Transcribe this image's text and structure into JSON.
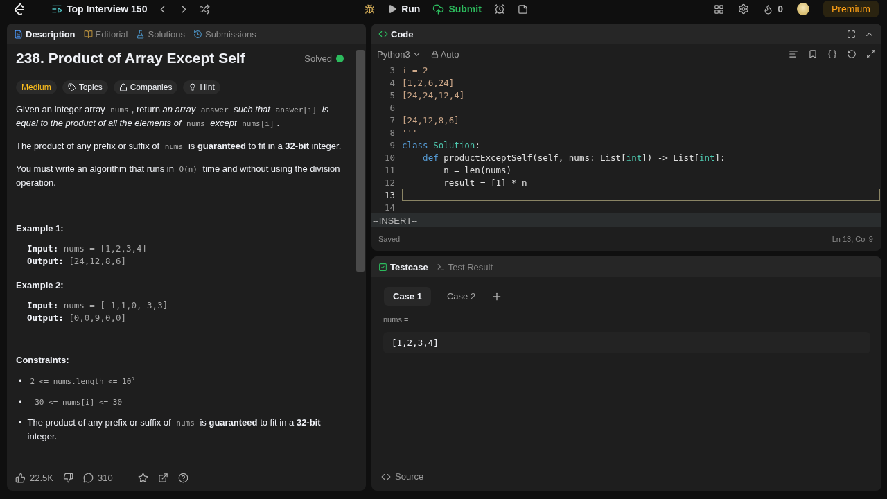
{
  "topbar": {
    "problem_list": "Top Interview 150",
    "run": "Run",
    "submit": "Submit",
    "streak": "0",
    "premium": "Premium"
  },
  "description_panel": {
    "tabs": [
      {
        "label": "Description",
        "selected": true
      },
      {
        "label": "Editorial",
        "selected": false
      },
      {
        "label": "Solutions",
        "selected": false
      },
      {
        "label": "Submissions",
        "selected": false
      }
    ],
    "title": "238. Product of Array Except Self",
    "status": "Solved",
    "difficulty": "Medium",
    "tags": [
      "Topics",
      "Companies",
      "Hint"
    ],
    "paragraphs": [
      [
        {
          "kind": "text",
          "t": "Given an integer array "
        },
        {
          "kind": "code",
          "t": "nums"
        },
        {
          "kind": "text",
          "t": ", return "
        },
        {
          "kind": "italic",
          "t": "an array "
        },
        {
          "kind": "code",
          "t": "answer"
        },
        {
          "kind": "italic",
          "t": " such that "
        },
        {
          "kind": "code",
          "t": "answer[i]"
        },
        {
          "kind": "italic",
          "t": " is equal to the product of all the elements of "
        },
        {
          "kind": "code",
          "t": "nums"
        },
        {
          "kind": "italic",
          "t": " except "
        },
        {
          "kind": "code",
          "t": "nums[i]"
        },
        {
          "kind": "text",
          "t": "."
        }
      ],
      [
        {
          "kind": "text",
          "t": "The product of any prefix or suffix of "
        },
        {
          "kind": "code",
          "t": "nums"
        },
        {
          "kind": "text",
          "t": " is **guaranteed** to fit in a **32-bit** integer."
        }
      ],
      [
        {
          "kind": "text",
          "t": "You must write an algorithm that runs in "
        },
        {
          "kind": "code",
          "t": "O(n)"
        },
        {
          "kind": "text",
          "t": " time and without using the division operation."
        }
      ]
    ],
    "examples": [
      {
        "title": "Example 1:",
        "lines": [
          {
            "label": "Input:",
            "value": "nums = [1,2,3,4]"
          },
          {
            "label": "Output:",
            "value": "[24,12,8,6]"
          }
        ]
      },
      {
        "title": "Example 2:",
        "lines": [
          {
            "label": "Input:",
            "value": "nums = [-1,1,0,-3,3]"
          },
          {
            "label": "Output:",
            "value": "[0,0,9,0,0]"
          }
        ]
      }
    ],
    "constraints_title": "Constraints:",
    "constraints": [
      {
        "bullet": "•",
        "segments": [
          {
            "kind": "code",
            "t": "2 <= nums.length <= 10$^{5}$"
          }
        ]
      },
      {
        "bullet": "•",
        "segments": [
          {
            "kind": "code",
            "t": "-30 <= nums[i] <= 30"
          }
        ]
      },
      {
        "bullet": "•",
        "segments": [
          {
            "kind": "text",
            "t": "The product of any prefix or suffix of "
          },
          {
            "kind": "code",
            "t": "nums"
          },
          {
            "kind": "text",
            "t": " is **guaranteed** to fit in a **32-bit** integer."
          }
        ]
      }
    ],
    "footer": {
      "likes": "22.5K",
      "comments": "310"
    }
  },
  "code_panel": {
    "title": "Code",
    "language": "Python3",
    "mode": "Auto",
    "lines": [
      {
        "number": "3",
        "active": false,
        "tokens": [
          {
            "kind": "str",
            "t": "i = 2"
          }
        ]
      },
      {
        "number": "4",
        "active": false,
        "tokens": [
          {
            "kind": "str",
            "t": "[1,2,6,24]"
          }
        ]
      },
      {
        "number": "5",
        "active": false,
        "tokens": [
          {
            "kind": "str",
            "t": "[24,24,12,4]"
          }
        ]
      },
      {
        "number": "6",
        "active": false
      },
      {
        "number": "7",
        "active": false,
        "tokens": [
          {
            "kind": "str",
            "t": "[24,12,8,6]"
          }
        ]
      },
      {
        "number": "8",
        "active": false,
        "tokens": [
          {
            "kind": "str",
            "t": "'''"
          }
        ]
      },
      {
        "number": "9",
        "active": false,
        "tokens": [
          {
            "kind": "kw",
            "t": "class"
          },
          {
            "kind": "cls",
            "t": " Solution"
          },
          {
            "kind": "plain",
            "t": ":"
          }
        ]
      },
      {
        "number": "10",
        "active": false,
        "tokens": [
          {
            "kind": "kw",
            "t": "    def"
          },
          {
            "kind": "plain",
            "t": " productExceptSelf(self, nums: List["
          },
          {
            "kind": "type",
            "t": "int"
          },
          {
            "kind": "plain",
            "t": "]) -> List["
          },
          {
            "kind": "type",
            "t": "int"
          },
          {
            "kind": "plain",
            "t": "]:"
          }
        ]
      },
      {
        "number": "11",
        "active": false,
        "tokens": [
          {
            "kind": "plain",
            "t": "        n = len(nums)"
          }
        ]
      },
      {
        "number": "12",
        "active": false,
        "tokens": [
          {
            "kind": "plain",
            "t": "        result = [1] * n"
          }
        ]
      },
      {
        "number": "13",
        "active": true
      },
      {
        "number": "14",
        "active": false
      }
    ],
    "vim_mode": "--INSERT--",
    "save_status": "Saved",
    "cursor": "Ln 13, Col 9"
  },
  "testcase_panel": {
    "tabs": [
      {
        "label": "Testcase",
        "selected": true
      },
      {
        "label": "Test Result",
        "selected": false
      }
    ],
    "cases": [
      {
        "label": "Case 1",
        "selected": true
      },
      {
        "label": "Case 2",
        "selected": false
      }
    ],
    "inputs": [
      {
        "label": "nums =",
        "value": "[1,2,3,4]"
      }
    ],
    "source": "Source"
  }
}
